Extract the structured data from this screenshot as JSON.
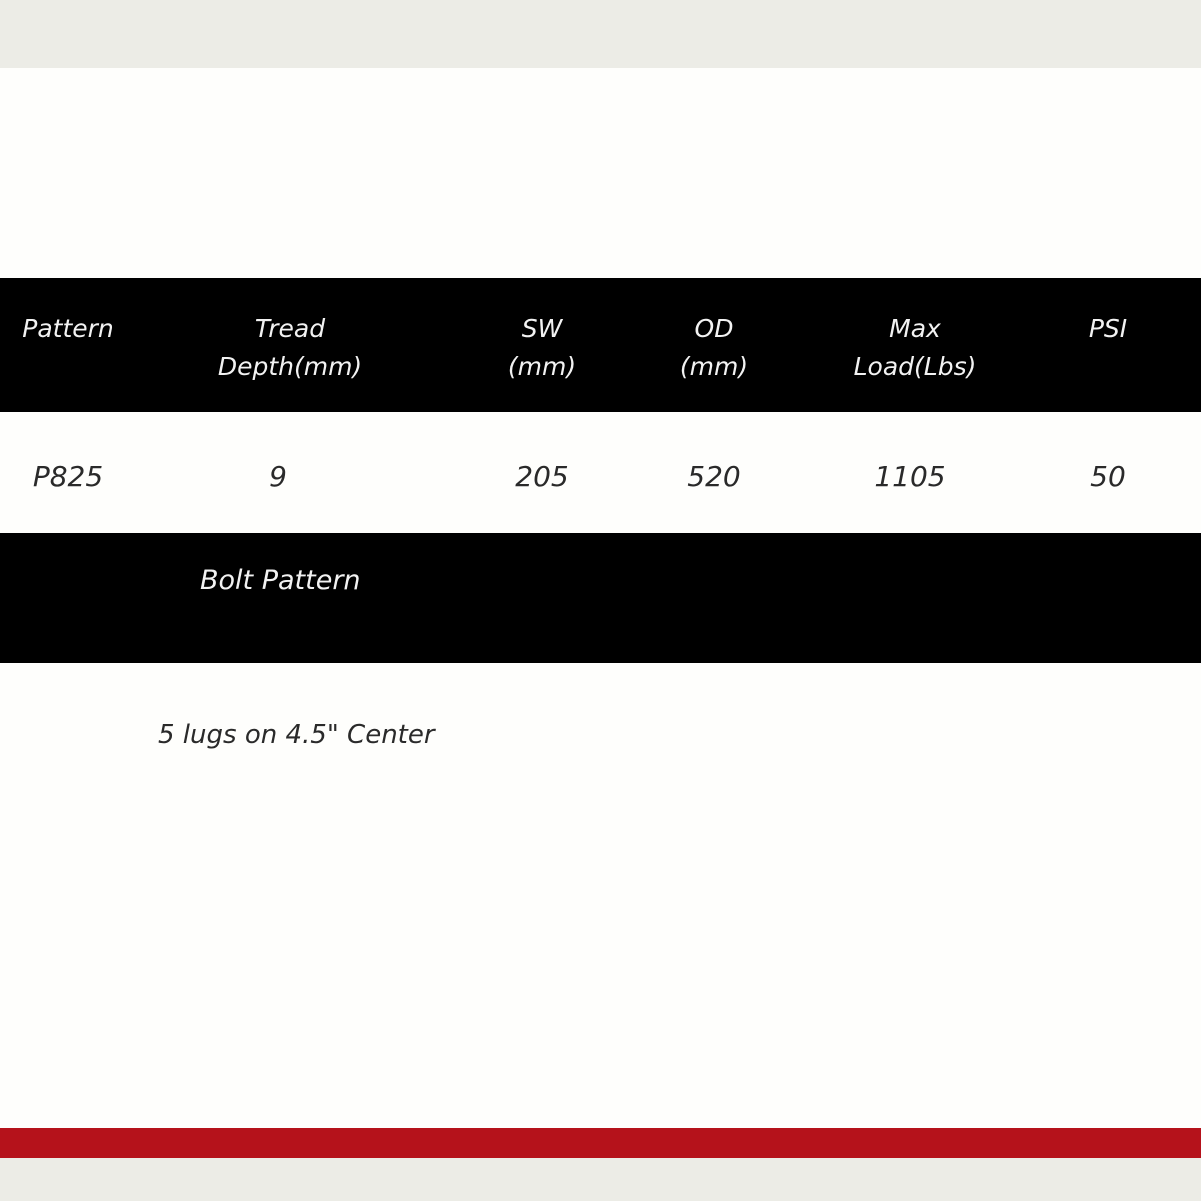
{
  "table": {
    "headers": {
      "pattern": "Pattern",
      "tread_depth": "Tread\nDepth(mm)",
      "sw": "SW\n(mm)",
      "od": "OD\n(mm)",
      "max_load": "Max\nLoad(Lbs)",
      "psi": "PSI"
    },
    "row": {
      "pattern": "P825",
      "tread_depth": "9",
      "sw": "205",
      "od": "520",
      "max_load": "1105",
      "psi": "50"
    }
  },
  "bolt": {
    "label": "Bolt Pattern",
    "value": "5 lugs on 4.5\" Center"
  },
  "colors": {
    "header_bg": "#000000",
    "accent_stripe": "#b5121b",
    "band": "#ecece6"
  }
}
